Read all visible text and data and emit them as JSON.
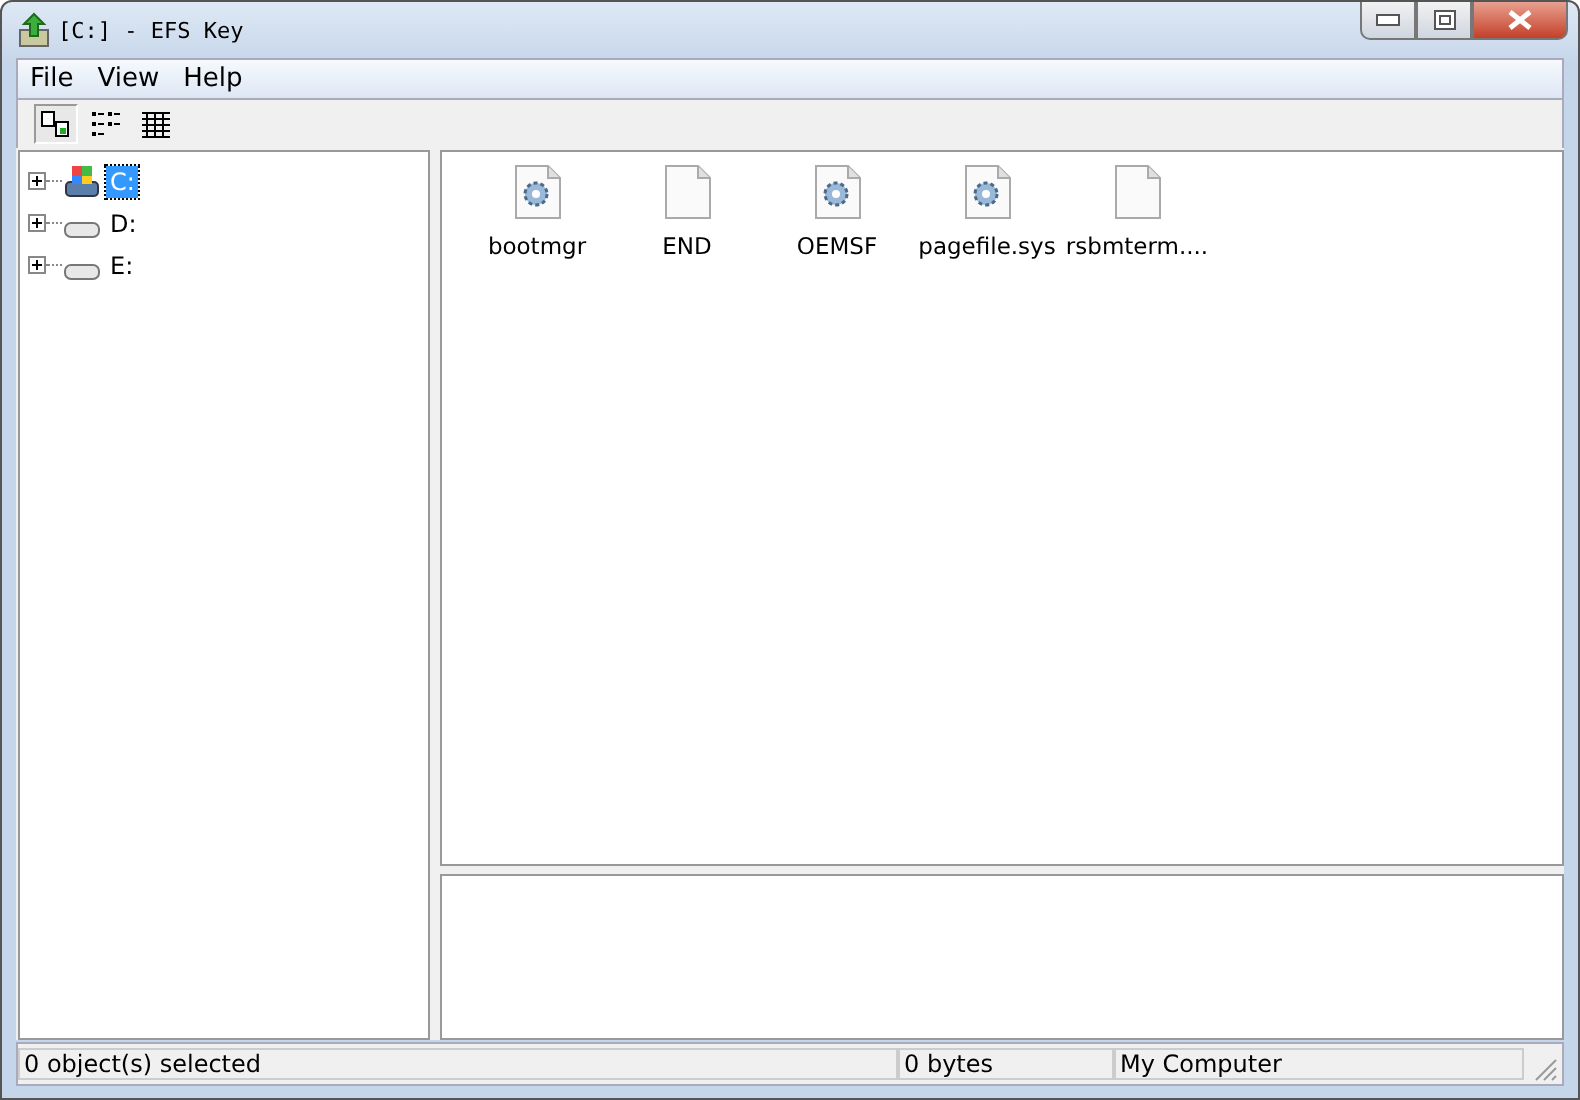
{
  "window": {
    "title": "[C:] - EFS Key"
  },
  "menu": [
    "File",
    "View",
    "Help"
  ],
  "toolbar": [
    {
      "kind": "large-icons",
      "selected": true
    },
    {
      "kind": "list",
      "selected": false
    },
    {
      "kind": "details",
      "selected": false
    }
  ],
  "tree": [
    {
      "label": "C:",
      "kind": "system",
      "selected": true,
      "expanded": false
    },
    {
      "label": "D:",
      "kind": "drive",
      "selected": false,
      "expanded": false
    },
    {
      "label": "E:",
      "kind": "drive",
      "selected": false,
      "expanded": false
    }
  ],
  "files": [
    {
      "name": "bootmgr",
      "kind": "system"
    },
    {
      "name": "END",
      "kind": "blank"
    },
    {
      "name": "OEMSF",
      "kind": "system"
    },
    {
      "name": "pagefile.sys",
      "kind": "system"
    },
    {
      "name": "rsbmterm....",
      "kind": "blank"
    }
  ],
  "status_bar": [
    "0 object(s) selected",
    "0 bytes",
    "My Computer"
  ]
}
